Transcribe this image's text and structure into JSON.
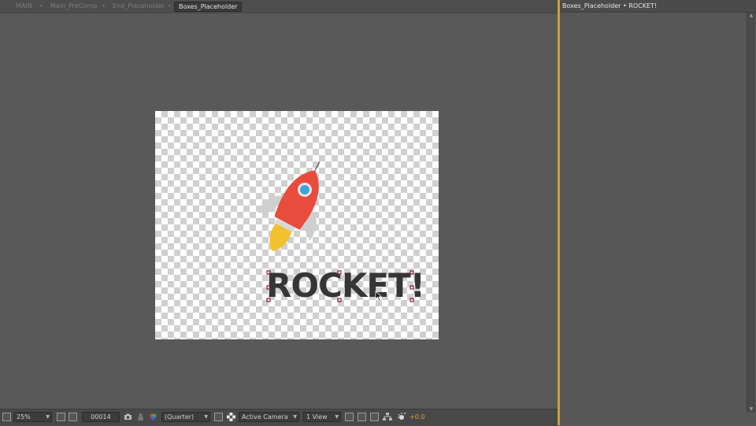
{
  "breadcrumbs": {
    "items": [
      {
        "label": "MAIN"
      },
      {
        "label": "Main_PreComp"
      },
      {
        "label": "End_Placeholder"
      },
      {
        "label": "Boxes_Placeholder"
      }
    ],
    "separator": "◂"
  },
  "canvas": {
    "text_layer": "ROCKET!"
  },
  "toolbar": {
    "zoom": "25%",
    "timecode": "00014",
    "resolution": "(Quarter)",
    "camera": "Active Camera",
    "views": "1 View",
    "exposure": "+0.0"
  },
  "right_panel": {
    "title": "Boxes_Placeholder • ROCKET!"
  },
  "colors": {
    "accent_divider": "#c9a13a",
    "exposure_text": "#d6a12a",
    "rocket_body": "#e84c3d",
    "rocket_flame": "#f2c12e",
    "rocket_window": "#3fa2d9",
    "text_fill": "#363636"
  },
  "icons": [
    "camera-icon",
    "color-channels-icon",
    "region-of-interest-icon",
    "transparency-grid-icon",
    "flowchart-icon",
    "fast-preview-icon",
    "toggle-mask-icon",
    "reset-exposure-icon"
  ]
}
